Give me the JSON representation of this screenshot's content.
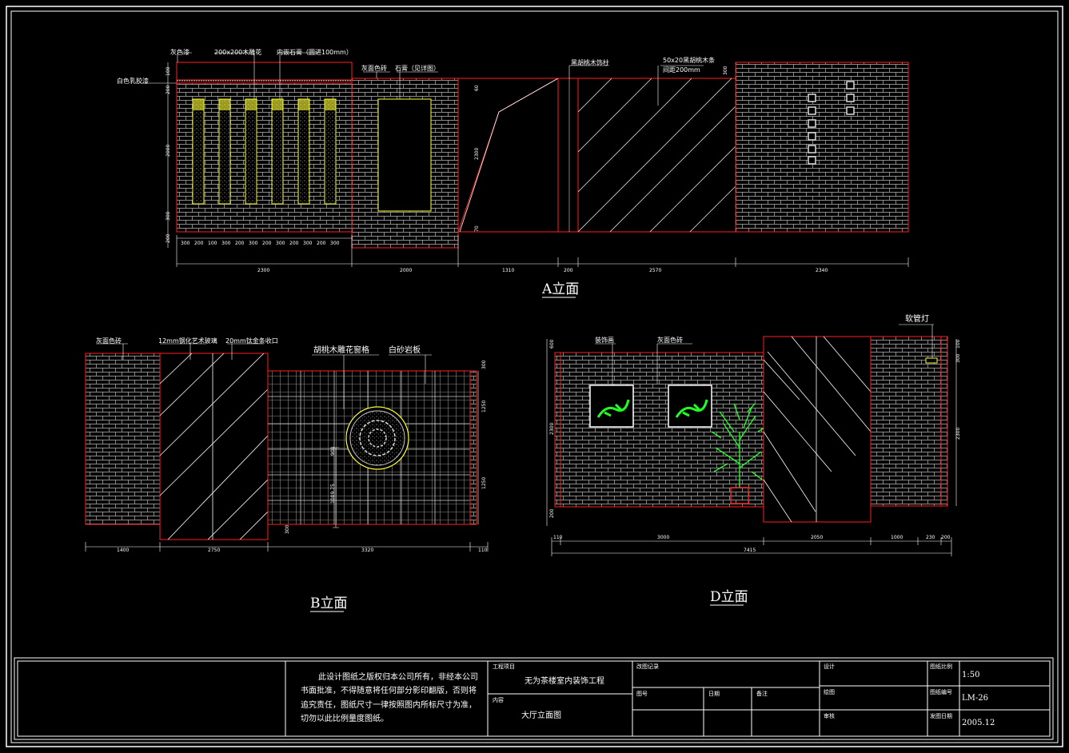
{
  "colors": {
    "background": "#000000",
    "frame": "#ffffff",
    "wall_outline": "#ff2020",
    "brick": "#bfbfbf",
    "glass": "#ffffff",
    "accent_yellow": "#ffff33",
    "plant": "#22ff22"
  },
  "elevation_a": {
    "title": "A立面",
    "labels": [
      "灰色漆",
      "200x200木雕花",
      "内嵌石膏（圆进100mm）",
      "白色乳胶漆",
      "灰面色砖",
      "石膏（见详图）",
      "黑胡桃木饰柱",
      "50x20黑胡桃木条",
      "间距200mm"
    ],
    "bottom_dims": [
      "2300",
      "2000",
      "1310",
      "200",
      "2570",
      "2340"
    ],
    "sub_dims": [
      "300",
      "200",
      "100",
      "300",
      "200",
      "300",
      "200",
      "300",
      "200",
      "300",
      "200",
      "300"
    ],
    "left_dims": [
      "100",
      "200",
      "2000",
      "300",
      "200"
    ],
    "mid_dims": [
      "60",
      "2300",
      "70"
    ],
    "right_dim": "300"
  },
  "elevation_b": {
    "title": "B立面",
    "labels": [
      "灰面色砖",
      "12mm钢化艺术玻璃",
      "20mm钛金条收口",
      "胡桃木雕花窗格",
      "白砂岩板"
    ],
    "bottom_dims": [
      "1400",
      "2750",
      "3320",
      "110"
    ],
    "right_dims": [
      "300",
      "1250",
      "1250"
    ],
    "inner_dims": [
      "900",
      "1009.75"
    ],
    "bottom_small": "300"
  },
  "elevation_d": {
    "title": "D立面",
    "labels": [
      "装饰画",
      "灰面色砖",
      "软管灯"
    ],
    "bottom_dims": [
      "110",
      "3000",
      "2050",
      "1000",
      "230",
      "200"
    ],
    "total_dim": "7415",
    "left_dims": [
      "600",
      "2300",
      "200"
    ],
    "right_dims": [
      "100",
      "300",
      "2300"
    ]
  },
  "title_block": {
    "notice": "此设计图纸之版权归本公司所有，非经本公司书面批准，不得随意将任何部分影印翻版，否则将追究责任。图纸尺寸一律按照图内所标尺寸为准，切勿以此比例量度图纸。",
    "notice_lines": [
      "此设计图纸之版权归本公司所有，非经本公司",
      "书面批准，不得随意将任何部分影印翻版，否则将",
      "追究责任，图纸尺寸一律按照图内所标尺寸为准，",
      "切勿以此比例量度图纸。"
    ],
    "project_label": "工程项目",
    "project_value": "无为茶楼室内装饰工程",
    "content_label": "内容",
    "content_value": "大厅立面图",
    "revision_label": "改图记录",
    "number_label": "图号",
    "date_label": "日期",
    "remark_label": "备注",
    "design_label": "设计",
    "draw_label": "绘图",
    "review_label": "审核",
    "scale_label": "图纸比例",
    "scale_value": "1:50",
    "code_label": "图纸编号",
    "code_value": "LM-26",
    "issue_label": "发图日期",
    "issue_value": "2005.12"
  }
}
